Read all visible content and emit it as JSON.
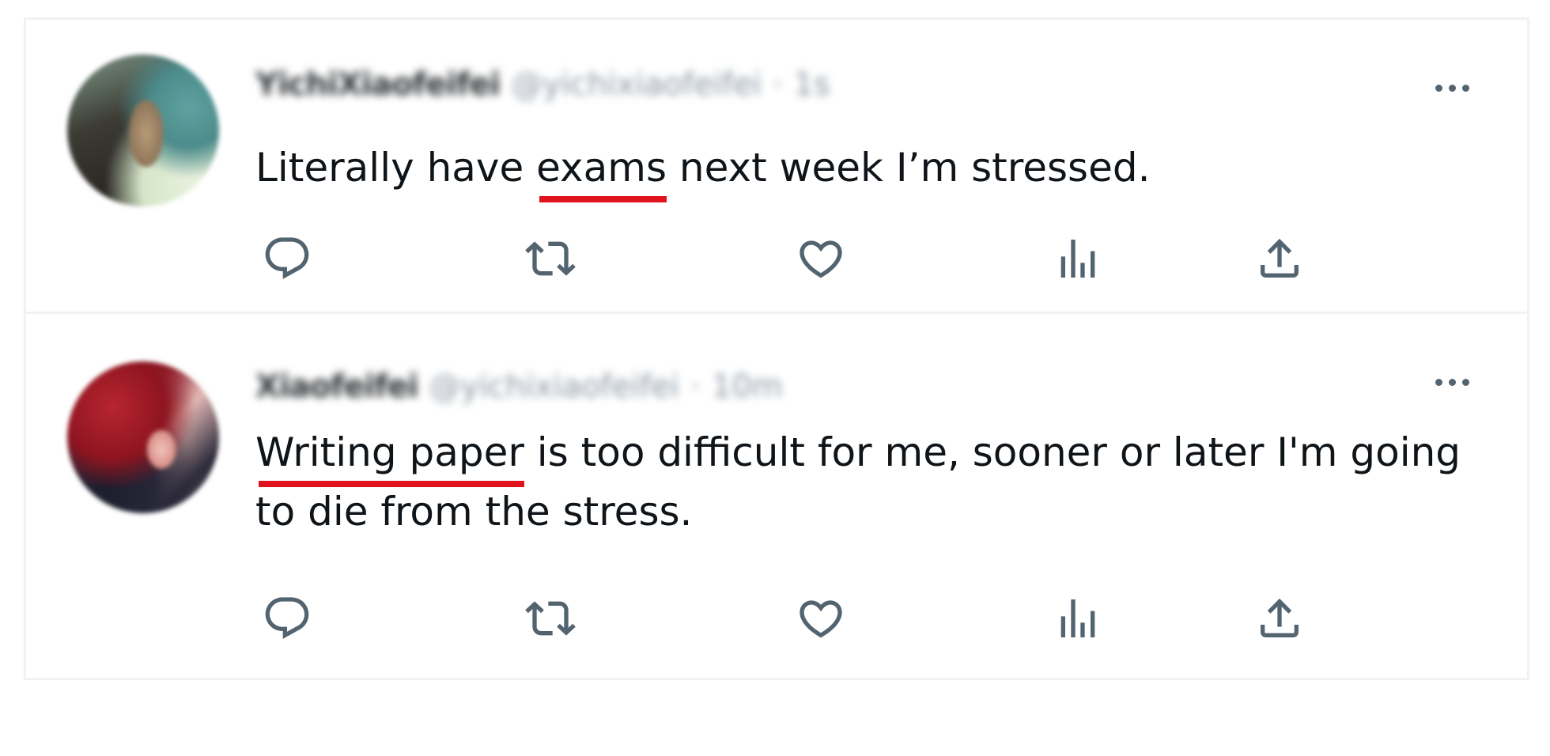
{
  "colors": {
    "text": "#0f1419",
    "icon": "#536471",
    "divider": "#eff3f4",
    "underline": "#e0141e"
  },
  "tweets": [
    {
      "name": "YichiXiaofeifei",
      "handle": "@yichixiaofeifei",
      "separator": "·",
      "time": "1s",
      "text_before": "Literally have ",
      "highlight": "exams",
      "text_after": " next week I’m stressed."
    },
    {
      "name": "Xiaofeifei",
      "handle": "@yichixiaofeifei",
      "separator": "·",
      "time": "10m",
      "text_before": "",
      "highlight": "Writing paper",
      "text_after": " is too difficult for me, sooner or later I'm going to die from the stress."
    }
  ],
  "actions": [
    {
      "icon": "reply-icon"
    },
    {
      "icon": "retweet-icon"
    },
    {
      "icon": "like-icon"
    },
    {
      "icon": "views-icon"
    },
    {
      "icon": "share-icon"
    }
  ]
}
